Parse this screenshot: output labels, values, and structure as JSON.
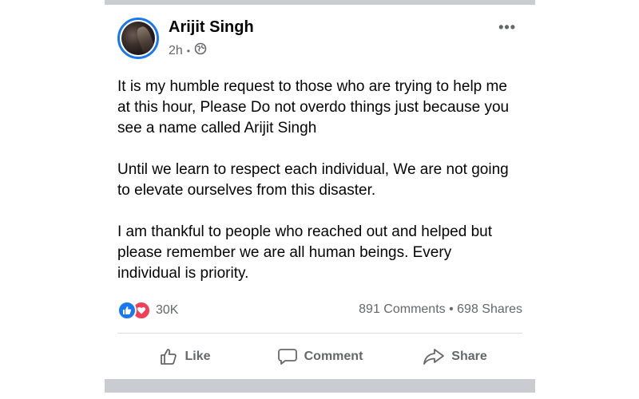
{
  "post": {
    "author": "Arijit Singh",
    "time": "2h",
    "separator": "•",
    "visibility_icon": "globe-icon",
    "more_icon": "•••",
    "paragraphs": [
      "It is my humble request to those who are trying to help me at this hour,  Please Do not overdo things just because you see a name called Arijit Singh",
      "Until we learn to respect each individual, We are not going to elevate ourselves from this disaster.",
      "I am thankful to people who reached out and helped but please remember we are all human beings. Every individual is priority."
    ]
  },
  "stats": {
    "reactions_count": "30K",
    "comments": "891 Comments",
    "dot": "•",
    "shares": "698 Shares"
  },
  "actions": {
    "like": "Like",
    "comment": "Comment",
    "share": "Share"
  },
  "colors": {
    "accent": "#1877f2",
    "love": "#f33e58",
    "muted_text": "#65676b",
    "frame": "#c9ccd1"
  }
}
